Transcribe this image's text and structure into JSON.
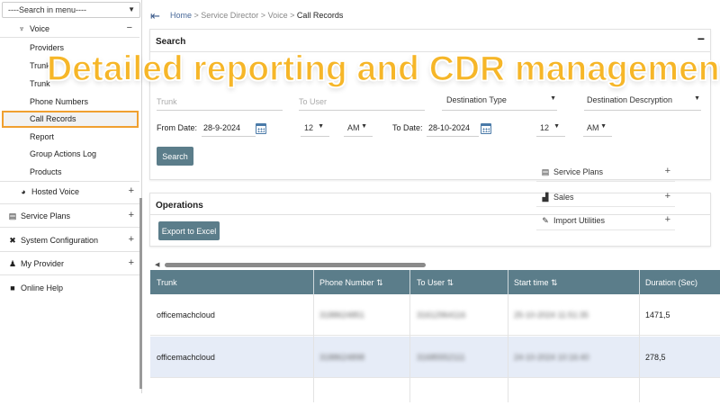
{
  "sidebar": {
    "search_placeholder": "----Search in menu----",
    "voice_label": "Voice",
    "voice_sub": [
      "Providers",
      "Trunks",
      "Trunk",
      "Phone Numbers",
      "Call Records",
      "Report",
      "Group Actions Log",
      "Products"
    ],
    "hosted_voice": "Hosted Voice",
    "service_plans": "Service Plans",
    "system_configuration": "System Configuration",
    "my_provider": "My Provider",
    "online_help": "Online Help"
  },
  "breadcrumb": {
    "home": "Home",
    "sep": " > ",
    "service_director": "Service Director",
    "voice": "Voice",
    "current": "Call Records"
  },
  "search_panel": {
    "title": "Search",
    "collapse": "−",
    "trunk_label": "Trunk",
    "to_user_label": "To User",
    "destination_type": "Destination Type",
    "destination_description": "Destination Descryption",
    "from_date_label": "From Date:",
    "from_date_value": "28-9-2024",
    "from_hour": "12",
    "from_ampm": "AM",
    "to_date_label": "To Date:",
    "to_date_value": "28-10-2024",
    "to_hour": "12",
    "to_ampm": "AM",
    "search_button": "Search"
  },
  "operations_panel": {
    "title": "Operations",
    "export_button": "Export to Excel"
  },
  "floating_menu": [
    {
      "label": "Service Plans",
      "icon": "service-plans-icon"
    },
    {
      "label": "Sales",
      "icon": "sales-icon"
    },
    {
      "label": "Import Utilities",
      "icon": "import-icon"
    }
  ],
  "table": {
    "columns": [
      "Trunk",
      "Phone Number",
      "To User",
      "Start time",
      "Duration (Sec)"
    ],
    "rows": [
      {
        "trunk": "officemachcloud",
        "phone": "3188624851",
        "to_user": "31612964116",
        "start": "25-10-2024 11:51:35",
        "duration": "1471,5"
      },
      {
        "trunk": "officemachcloud",
        "phone": "3188624898",
        "to_user": "31685552111",
        "start": "24-10-2024 10:16:40",
        "duration": "278,5"
      }
    ]
  },
  "overlay": {
    "banner": "Detailed reporting and CDR management"
  },
  "colors": {
    "accent": "#5b7d8a",
    "highlight_border": "#f0a030",
    "banner_text": "#f6b628",
    "alt_row": "#e6ecf7"
  }
}
